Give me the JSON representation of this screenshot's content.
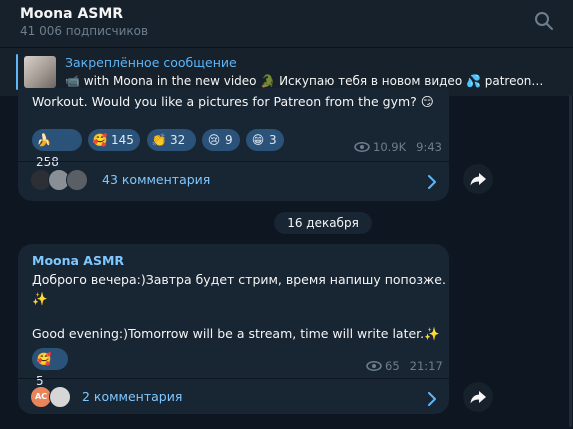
{
  "header": {
    "title": "Moona ASMR",
    "subtitle": "41 006 подписчиков"
  },
  "pinned": {
    "title": "Закреплённое сообщение",
    "text": "📹 with Moona in the new video 🐊 Искупаю тебя в новом видео 💦 patreon…"
  },
  "message1": {
    "text": "Workout. Would you like a pictures for Patreon from the gym? 😏",
    "reactions": [
      {
        "emoji": "🍌",
        "count": "258"
      },
      {
        "emoji": "🥰",
        "count": "145"
      },
      {
        "emoji": "👏",
        "count": "32"
      },
      {
        "emoji": "😢",
        "count": "9"
      },
      {
        "emoji": "😁",
        "count": "3"
      }
    ],
    "views": "10.9K",
    "time": "9:43",
    "comments": "43 комментария"
  },
  "date_separator": "16 декабря",
  "message2": {
    "sender": "Moona ASMR",
    "line1": "Доброго вечера:)Завтра будет стрим, время напишу попозже.",
    "line2": "✨",
    "line3": "Good evening:)Tomorrow will be a stream, time will write later.✨",
    "reactions": [
      {
        "emoji": "🥰",
        "count": "5"
      }
    ],
    "views": "65",
    "time": "21:17",
    "comments": "2 комментария",
    "avatar_initials": "AC"
  },
  "colors": {
    "background": "#0e1621",
    "panel": "#17212b",
    "bubble": "#182533",
    "accent": "#5eb5f7",
    "reaction": "#2b5278"
  }
}
